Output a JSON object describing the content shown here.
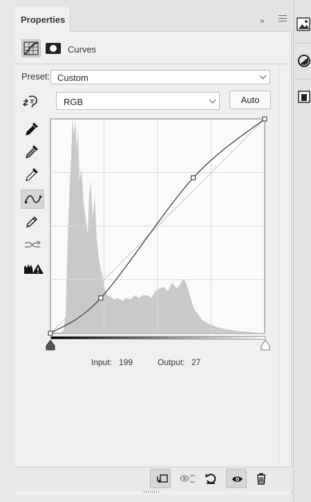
{
  "panel": {
    "tab_label": "Properties",
    "collapse_glyph": "»",
    "adjustment_title": "Curves"
  },
  "preset": {
    "label": "Preset:",
    "value": "Custom"
  },
  "channel": {
    "value": "RGB",
    "auto_label": "Auto"
  },
  "readout": {
    "input_label": "Input:",
    "input_value": "199",
    "output_label": "Output:",
    "output_value": "27"
  },
  "curve": {
    "control_points": [
      {
        "input": 0,
        "output": 0
      },
      {
        "input": 60,
        "output": 42
      },
      {
        "input": 170,
        "output": 185
      },
      {
        "input": 255,
        "output": 255
      }
    ]
  },
  "tools": [
    {
      "name": "sample-shadows-eyedropper-icon"
    },
    {
      "name": "sample-midtones-eyedropper-icon"
    },
    {
      "name": "sample-highlights-eyedropper-icon"
    },
    {
      "name": "edit-points-curve-icon"
    },
    {
      "name": "draw-pencil-icon"
    },
    {
      "name": "smooth-curve-icon"
    },
    {
      "name": "clipping-warning-icon"
    }
  ],
  "footer": {
    "buttons": [
      "clip-to-layer-icon",
      "view-previous-state-icon",
      "reset-icon",
      "visibility-eye-icon",
      "delete-trash-icon"
    ]
  },
  "colors": {
    "panel_bg": "#f0f0f0",
    "histogram": "#c9c9c9",
    "grid": "#d8d8d8",
    "curve": "#333333"
  }
}
